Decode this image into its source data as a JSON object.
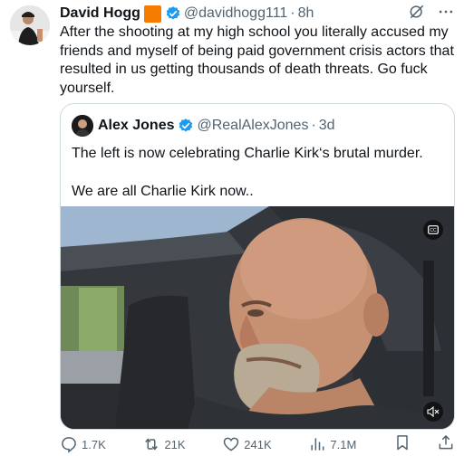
{
  "post": {
    "author_name": "David Hogg",
    "handle": "@davidhogg111",
    "separator": "·",
    "time": "8h",
    "text": "After the shooting at my high school you literally accused my friends and myself of being paid government crisis actors that resulted in us getting thousands of death threats. Go fuck yourself."
  },
  "quote": {
    "author_name": "Alex Jones",
    "handle": "@RealAlexJones",
    "separator": "·",
    "time": "3d",
    "text": "The left is now celebrating Charlie Kirk‘s brutal murder.\n\nWe are all Charlie Kirk now.."
  },
  "actions": {
    "replies": "1.7K",
    "reposts": "21K",
    "likes": "241K",
    "views": "7.1M"
  },
  "colors": {
    "accent": "#1d9bf0",
    "badge": "#f57c00",
    "secondary_text": "#536471",
    "border": "#cfd9de"
  },
  "icons": [
    "grok-icon",
    "more-icon",
    "verified-icon",
    "closed-captions-icon",
    "mute-icon",
    "reply-icon",
    "repost-icon",
    "like-icon",
    "views-icon",
    "bookmark-icon",
    "share-icon"
  ]
}
